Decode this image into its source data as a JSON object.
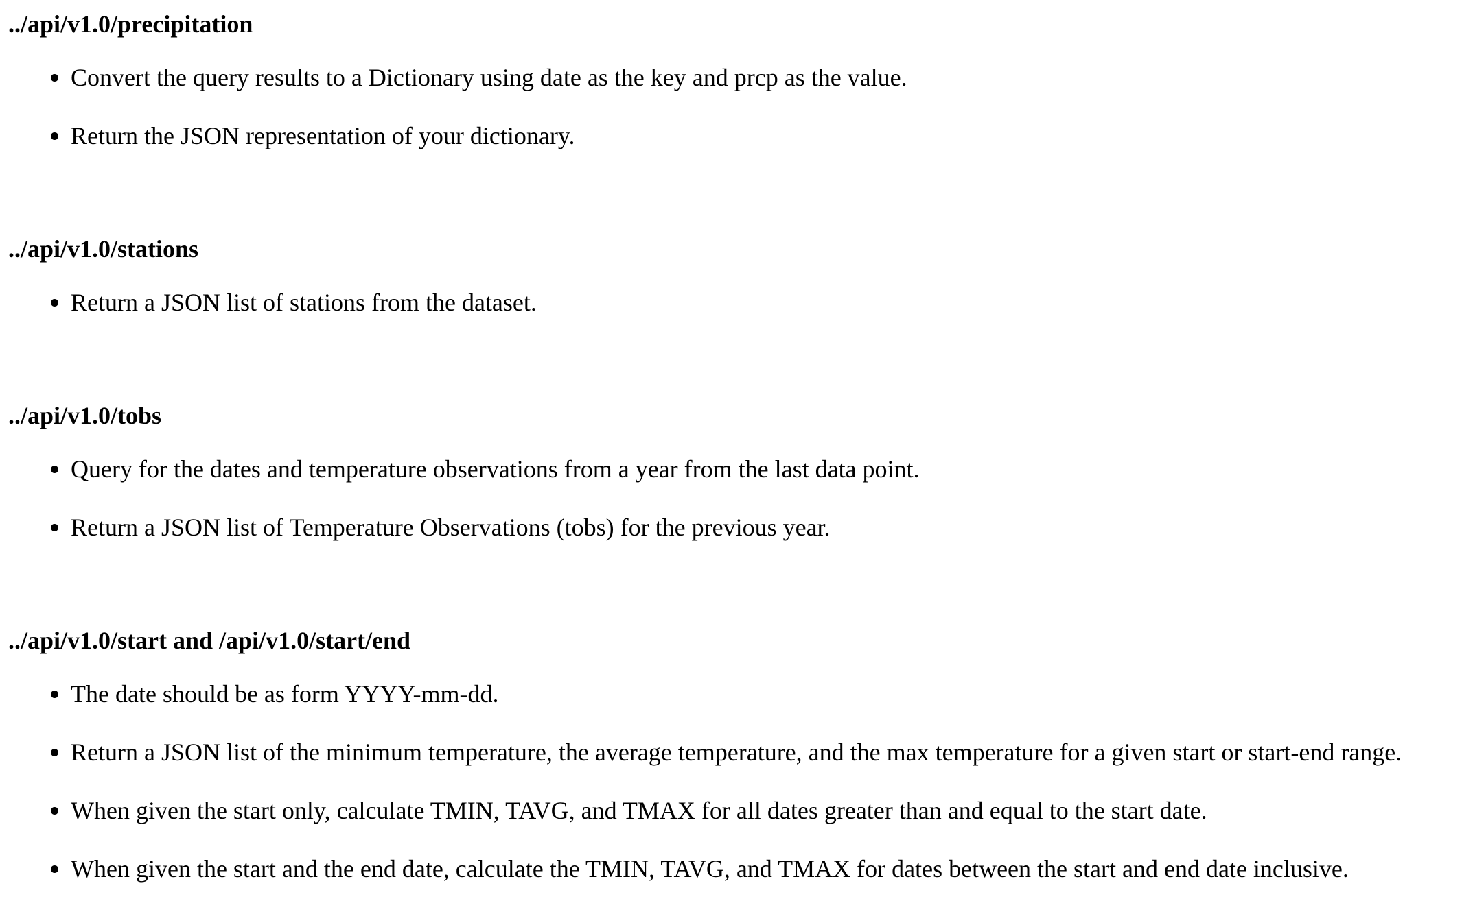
{
  "sections": [
    {
      "heading": "../api/v1.0/precipitation",
      "items": [
        "Convert the query results to a Dictionary using date as the key and prcp as the value.",
        "Return the JSON representation of your dictionary."
      ]
    },
    {
      "heading": "../api/v1.0/stations",
      "items": [
        "Return a JSON list of stations from the dataset."
      ]
    },
    {
      "heading": "../api/v1.0/tobs",
      "items": [
        "Query for the dates and temperature observations from a year from the last data point.",
        "Return a JSON list of Temperature Observations (tobs) for the previous year."
      ]
    },
    {
      "heading": "../api/v1.0/start and /api/v1.0/start/end",
      "items": [
        "The date should be as form YYYY-mm-dd.",
        "Return a JSON list of the minimum temperature, the average temperature, and the max temperature for a given start or start-end range.",
        "When given the start only, calculate TMIN, TAVG, and TMAX for all dates greater than and equal to the start date.",
        "When given the start and the end date, calculate the TMIN, TAVG, and TMAX for dates between the start and end date inclusive."
      ]
    }
  ]
}
